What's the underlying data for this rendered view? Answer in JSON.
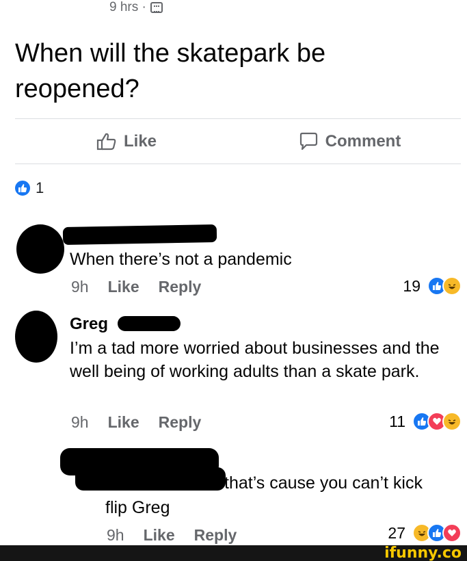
{
  "post": {
    "timestamp": "9 hrs ·",
    "text": "When will the skatepark be reopened?"
  },
  "actions": {
    "like_label": "Like",
    "comment_label": "Comment"
  },
  "reactions_summary": {
    "count": "1"
  },
  "comments": [
    {
      "author": "",
      "text": "When there’s not a pandemic",
      "time": "9h",
      "like_label": "Like",
      "reply_label": "Reply",
      "reaction_count": "19"
    },
    {
      "author": "Greg",
      "text": "I’m a tad more worried about businesses and the well being of working adults than a skate park.",
      "time": "9h",
      "like_label": "Like",
      "reply_label": "Reply",
      "reaction_count": "11"
    },
    {
      "author": "",
      "text_line1": "that’s cause you can’t kick",
      "text_line2": "flip Greg",
      "time": "9h",
      "like_label": "Like",
      "reply_label": "Reply",
      "reaction_count": "27"
    }
  ],
  "watermark": "ifunny.co",
  "colors": {
    "meta_gray": "#65676b",
    "like_blue": "#1877f2",
    "love_red": "#f33e58",
    "haha_yellow": "#f7b928",
    "watermark_yellow": "#f7c800"
  }
}
